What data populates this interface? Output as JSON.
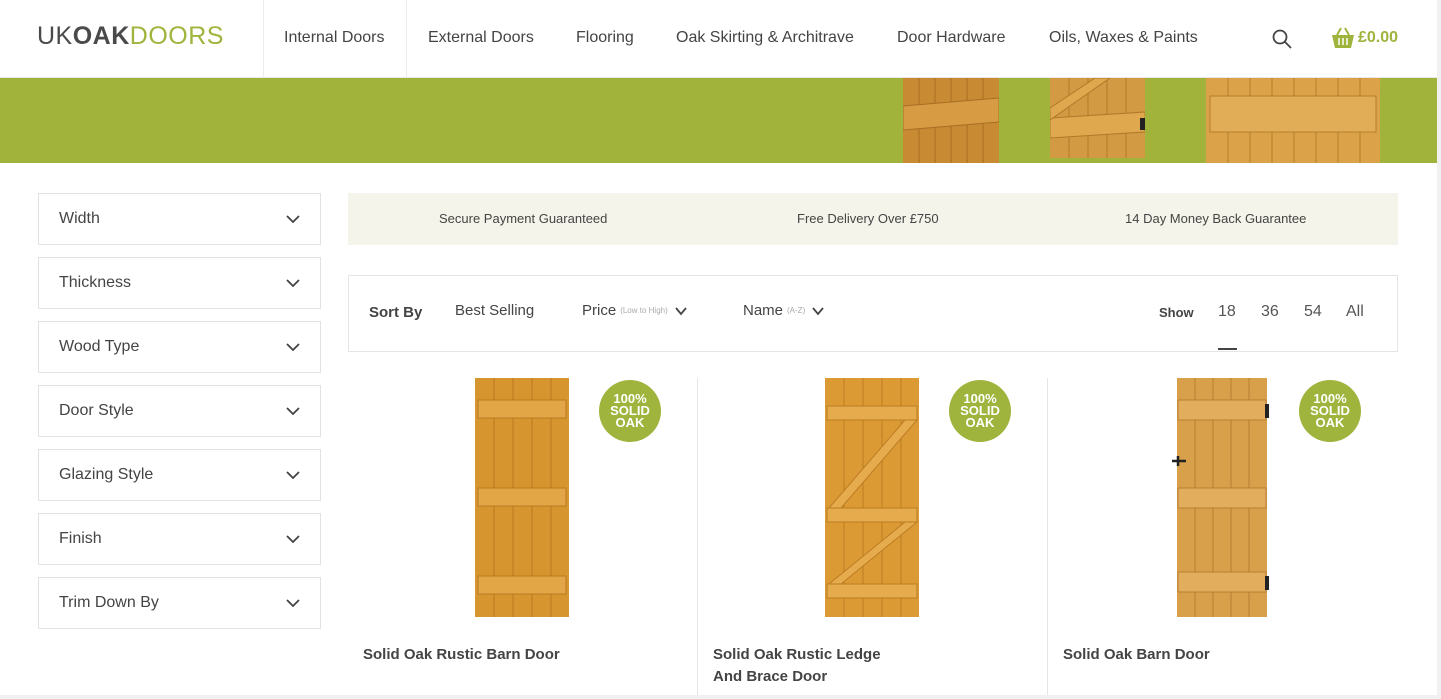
{
  "logo": {
    "part1": "UK",
    "part2": "OAK",
    "part3": "DOORS"
  },
  "nav": [
    {
      "label": "Internal Doors"
    },
    {
      "label": "External Doors"
    },
    {
      "label": "Flooring"
    },
    {
      "label": "Oak Skirting & Architrave"
    },
    {
      "label": "Door Hardware"
    },
    {
      "label": "Oils, Waxes & Paints"
    }
  ],
  "header": {
    "basket_amount": "£0.00"
  },
  "filters": [
    {
      "label": "Width"
    },
    {
      "label": "Thickness"
    },
    {
      "label": "Wood Type"
    },
    {
      "label": "Door Style"
    },
    {
      "label": "Glazing Style"
    },
    {
      "label": "Finish"
    },
    {
      "label": "Trim Down By"
    }
  ],
  "guarantees": [
    {
      "label": "Secure Payment Guaranteed"
    },
    {
      "label": "Free Delivery Over £750"
    },
    {
      "label": "14 Day Money Back Guarantee"
    }
  ],
  "sort": {
    "label": "Sort By",
    "best_selling": "Best Selling",
    "price": "Price",
    "price_sub": "(Low to High)",
    "name": "Name",
    "name_sub": "(A-Z)"
  },
  "show": {
    "label": "Show",
    "options": [
      "18",
      "36",
      "54",
      "All"
    ],
    "selected": "18"
  },
  "badge": {
    "line1": "100%",
    "line2": "SOLID",
    "line3": "OAK"
  },
  "products": [
    {
      "name": "Solid Oak Rustic Barn Door"
    },
    {
      "name": "Solid Oak Rustic Ledge And Brace Door"
    },
    {
      "name": "Solid Oak Barn Door"
    }
  ],
  "colors": {
    "brand_green": "#9fb43c",
    "banner_green": "#a1b33b",
    "guarantee_bg": "#f4f4ea",
    "oak": "#d99a3a"
  }
}
